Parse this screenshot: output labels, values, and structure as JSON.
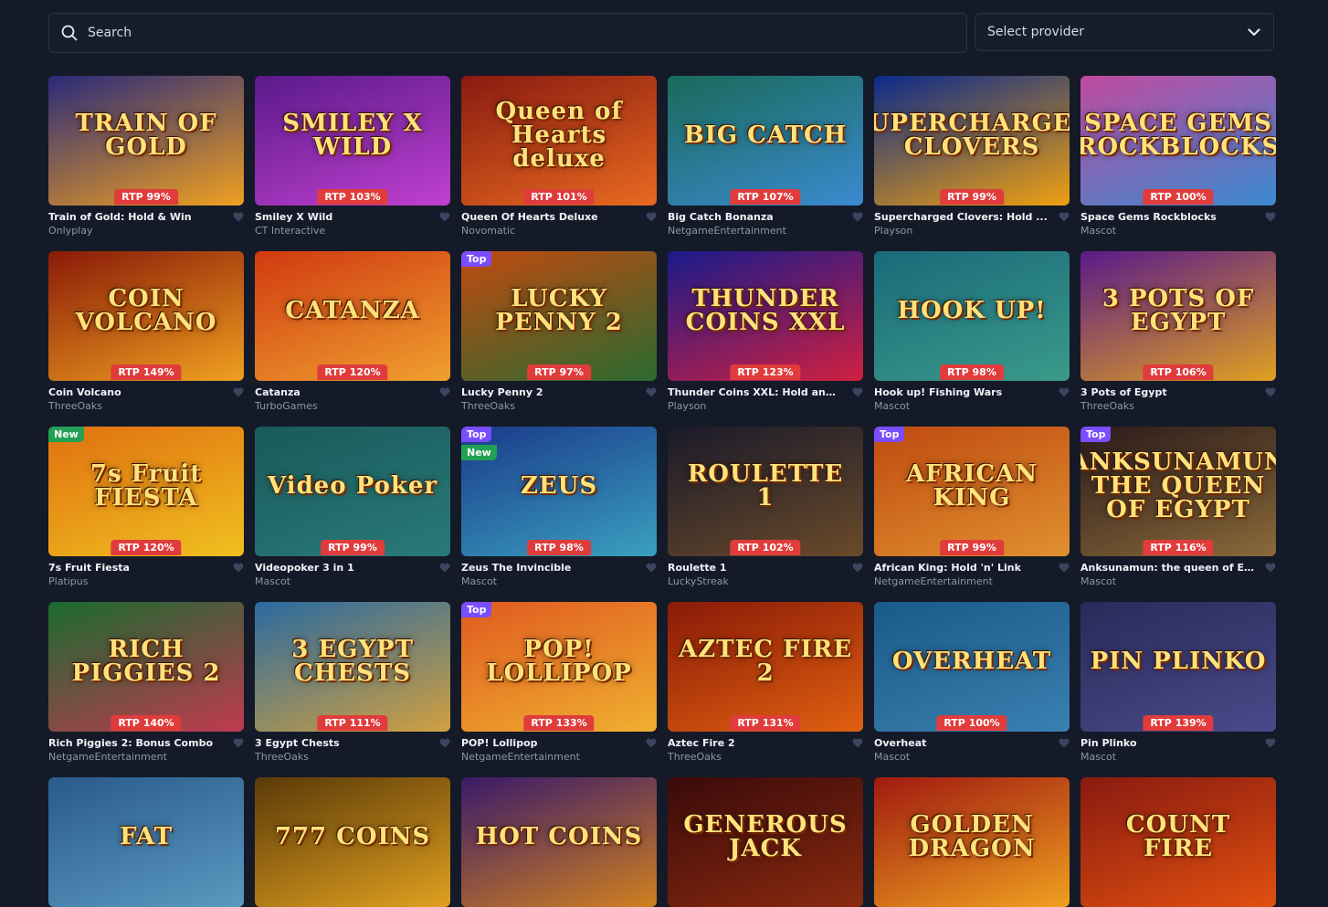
{
  "search": {
    "placeholder": "Search"
  },
  "provider_select": {
    "label": "Select provider"
  },
  "icons": {
    "search": "search-icon",
    "chevron": "chevron-down-icon",
    "favorite": "heart-icon"
  },
  "games": [
    {
      "title": "Train of Gold: Hold & Win",
      "provider": "Onlyplay",
      "rtp": "RTP 99%",
      "art": "TRAIN OF GOLD",
      "badge": "",
      "badge2": "",
      "colors": [
        "#2a2a7a",
        "#f0a020"
      ]
    },
    {
      "title": "Smiley X Wild",
      "provider": "CT Interactive",
      "rtp": "RTP 103%",
      "art": "SMILEY X WILD",
      "badge": "",
      "badge2": "",
      "colors": [
        "#5a1a8a",
        "#c040d0"
      ]
    },
    {
      "title": "Queen Of Hearts Deluxe",
      "provider": "Novomatic",
      "rtp": "RTP 101%",
      "art": "Queen of Hearts deluxe",
      "badge": "",
      "badge2": "",
      "colors": [
        "#8a1a10",
        "#e86a20"
      ]
    },
    {
      "title": "Big Catch Bonanza",
      "provider": "NetgameEntertainment",
      "rtp": "RTP 107%",
      "art": "BIG CATCH",
      "badge": "",
      "badge2": "",
      "colors": [
        "#1a6a5a",
        "#3a8ad0"
      ]
    },
    {
      "title": "Supercharged Clovers: Hold ...",
      "provider": "Playson",
      "rtp": "RTP 99%",
      "art": "SUPERCHARGED CLOVERS",
      "badge": "",
      "badge2": "",
      "colors": [
        "#0a2a8a",
        "#f0a010"
      ]
    },
    {
      "title": "Space Gems Rockblocks",
      "provider": "Mascot",
      "rtp": "RTP 100%",
      "art": "SPACE GEMS ROCKBLOCKS",
      "badge": "",
      "badge2": "",
      "colors": [
        "#c04aa0",
        "#3a8ad0"
      ]
    },
    {
      "title": "Coin Volcano",
      "provider": "ThreeOaks",
      "rtp": "RTP 149%",
      "art": "COIN VOLCANO",
      "badge": "",
      "badge2": "",
      "colors": [
        "#8a1a08",
        "#f0a020"
      ]
    },
    {
      "title": "Catanza",
      "provider": "TurboGames",
      "rtp": "RTP 120%",
      "art": "CATANZA",
      "badge": "",
      "badge2": "",
      "colors": [
        "#d03a10",
        "#f0a030"
      ]
    },
    {
      "title": "Lucky Penny 2",
      "provider": "ThreeOaks",
      "rtp": "RTP 97%",
      "art": "LUCKY PENNY 2",
      "badge": "Top",
      "badge2": "",
      "colors": [
        "#c04a10",
        "#2a6a30"
      ]
    },
    {
      "title": "Thunder Coins XXL: Hold and...",
      "provider": "Playson",
      "rtp": "RTP 123%",
      "art": "THUNDER COINS XXL",
      "badge": "",
      "badge2": "",
      "colors": [
        "#1a1a8a",
        "#d02040"
      ]
    },
    {
      "title": "Hook up! Fishing Wars",
      "provider": "Mascot",
      "rtp": "RTP 98%",
      "art": "HOOK UP!",
      "badge": "",
      "badge2": "",
      "colors": [
        "#1a6a7a",
        "#3a9a8a"
      ]
    },
    {
      "title": "3 Pots of Egypt",
      "provider": "ThreeOaks",
      "rtp": "RTP 106%",
      "art": "3 POTS OF EGYPT",
      "badge": "",
      "badge2": "",
      "colors": [
        "#5a1a8a",
        "#e0a020"
      ]
    },
    {
      "title": "7s Fruit Fiesta",
      "provider": "Platipus",
      "rtp": "RTP 120%",
      "art": "7s Fruit FIESTA",
      "badge": "New",
      "badge2": "",
      "colors": [
        "#e07010",
        "#f0c020"
      ]
    },
    {
      "title": "Videopoker 3 in 1",
      "provider": "Mascot",
      "rtp": "RTP 99%",
      "art": "Video Poker",
      "badge": "",
      "badge2": "",
      "colors": [
        "#1a5a5a",
        "#2a7a7a"
      ]
    },
    {
      "title": "Zeus The Invincible",
      "provider": "Mascot",
      "rtp": "RTP 98%",
      "art": "ZEUS",
      "badge": "Top",
      "badge2": "New",
      "colors": [
        "#1a3a8a",
        "#3aa0c0"
      ]
    },
    {
      "title": "Roulette 1",
      "provider": "LuckyStreak",
      "rtp": "RTP 102%",
      "art": "ROULETTE 1",
      "badge": "",
      "badge2": "",
      "colors": [
        "#1a1a2a",
        "#6a4a2a"
      ]
    },
    {
      "title": "African King: Hold 'n' Link",
      "provider": "NetgameEntertainment",
      "rtp": "RTP 99%",
      "art": "AFRICAN KING",
      "badge": "Top",
      "badge2": "",
      "colors": [
        "#c04a10",
        "#e09030"
      ]
    },
    {
      "title": "Anksunamun: the queen of E...",
      "provider": "Mascot",
      "rtp": "RTP 116%",
      "art": "ANKSUNAMUN THE QUEEN OF EGYPT",
      "badge": "Top",
      "badge2": "",
      "colors": [
        "#2a1a1a",
        "#8a6a3a"
      ]
    },
    {
      "title": "Rich Piggies 2: Bonus Combo",
      "provider": "NetgameEntertainment",
      "rtp": "RTP 140%",
      "art": "RICH PIGGIES 2",
      "badge": "",
      "badge2": "",
      "colors": [
        "#1a6a30",
        "#c03a50"
      ]
    },
    {
      "title": "3 Egypt Chests",
      "provider": "ThreeOaks",
      "rtp": "RTP 111%",
      "art": "3 EGYPT CHESTS",
      "badge": "",
      "badge2": "",
      "colors": [
        "#2a6aa0",
        "#d0a040"
      ]
    },
    {
      "title": "POP! Lollipop",
      "provider": "NetgameEntertainment",
      "rtp": "RTP 133%",
      "art": "POP! LOLLIPOP",
      "badge": "Top",
      "badge2": "",
      "colors": [
        "#e05a20",
        "#f0b030"
      ]
    },
    {
      "title": "Aztec Fire 2",
      "provider": "ThreeOaks",
      "rtp": "RTP 131%",
      "art": "AZTEC FIRE 2",
      "badge": "",
      "badge2": "",
      "colors": [
        "#8a1a08",
        "#e06010"
      ]
    },
    {
      "title": "Overheat",
      "provider": "Mascot",
      "rtp": "RTP 100%",
      "art": "OVERHEAT",
      "badge": "",
      "badge2": "",
      "colors": [
        "#1a5a8a",
        "#3a80b0"
      ]
    },
    {
      "title": "Pin Plinko",
      "provider": "Mascot",
      "rtp": "RTP 139%",
      "art": "PIN PLINKO",
      "badge": "",
      "badge2": "",
      "colors": [
        "#2a2a5a",
        "#4a4a8a"
      ]
    },
    {
      "title": "",
      "provider": "",
      "rtp": "",
      "art": "FAT",
      "badge": "",
      "badge2": "",
      "colors": [
        "#2a5a8a",
        "#5a9ac0"
      ]
    },
    {
      "title": "",
      "provider": "",
      "rtp": "",
      "art": "777 COINS",
      "badge": "",
      "badge2": "",
      "colors": [
        "#5a3a08",
        "#e0a020"
      ]
    },
    {
      "title": "",
      "provider": "",
      "rtp": "",
      "art": "HOT COINS",
      "badge": "",
      "badge2": "",
      "colors": [
        "#3a1a6a",
        "#d08020"
      ]
    },
    {
      "title": "",
      "provider": "",
      "rtp": "",
      "art": "GENEROUS JACK",
      "badge": "",
      "badge2": "",
      "colors": [
        "#3a0a0a",
        "#8a2a10"
      ]
    },
    {
      "title": "",
      "provider": "",
      "rtp": "",
      "art": "GOLDEN DRAGON",
      "badge": "",
      "badge2": "",
      "colors": [
        "#a01a10",
        "#f0a020"
      ]
    },
    {
      "title": "",
      "provider": "",
      "rtp": "",
      "art": "COUNT FIRE",
      "badge": "",
      "badge2": "",
      "colors": [
        "#8a1a10",
        "#e05010"
      ]
    }
  ]
}
